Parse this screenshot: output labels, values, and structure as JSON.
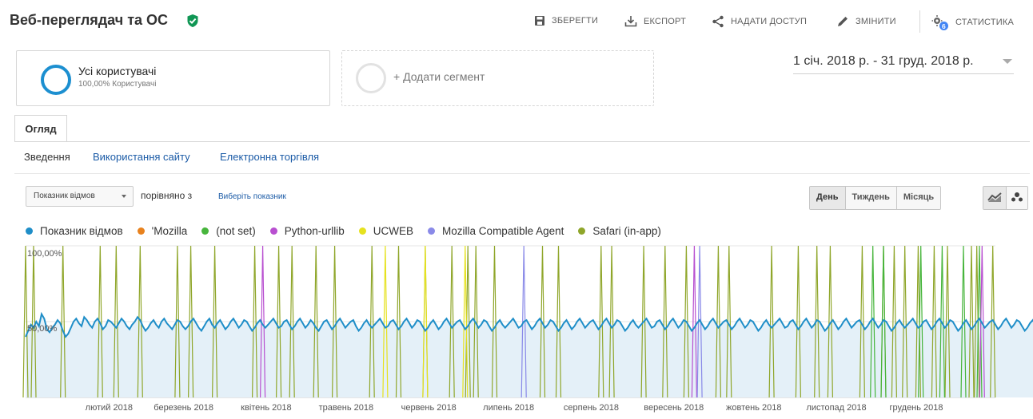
{
  "header": {
    "title": "Веб-переглядач та ОС",
    "save_label": "ЗБЕРЕГТИ",
    "export_label": "ЕКСПОРТ",
    "share_label": "НАДАТИ ДОСТУП",
    "edit_label": "ЗМІНИТИ",
    "insights_label": "СТАТИСТИКА",
    "insights_badge": "6"
  },
  "segments": {
    "active_name": "Усі користувачі",
    "active_sub": "100,00% Користувачі",
    "add_label": "+ Додати сегмент"
  },
  "date_range": "1 січ. 2018 р. - 31 груд. 2018 р.",
  "tabs": [
    "Огляд"
  ],
  "subnav": [
    "Зведення",
    "Використання сайту",
    "Електронна торгівля"
  ],
  "controls": {
    "metric_label": "Показник відмов",
    "compare_label": "порівняно з",
    "select_metric": "Виберіть показник",
    "granularity": [
      "День",
      "Тиждень",
      "Місяць"
    ],
    "active_granularity": "День"
  },
  "legend": [
    {
      "name": "Показник відмов",
      "color": "#1f8ec8"
    },
    {
      "name": "'Mozilla",
      "color": "#e8821e"
    },
    {
      "name": "(not set)",
      "color": "#47b53c"
    },
    {
      "name": "Python-urllib",
      "color": "#b84fd0"
    },
    {
      "name": "UCWEB",
      "color": "#e6e21e"
    },
    {
      "name": "Mozilla Compatible Agent",
      "color": "#8a8ae8"
    },
    {
      "name": "Safari (in-app)",
      "color": "#8fa62a"
    }
  ],
  "chart_data": {
    "type": "line",
    "title": "",
    "xlabel": "",
    "ylabel": "",
    "ylim": [
      0,
      100
    ],
    "y_ticks": [
      "100,00%",
      "50,00%"
    ],
    "x_tick_labels": [
      "лютий 2018",
      "березень 2018",
      "квітень 2018",
      "травень 2018",
      "червень 2018",
      "липень 2018",
      "серпень 2018",
      "вересень 2018",
      "жовтень 2018",
      "листопад 2018",
      "грудень 2018"
    ],
    "x_range": [
      "2018-01-01",
      "2018-12-31"
    ],
    "series": [
      {
        "name": "Показник відмов",
        "values": [
          40,
          44,
          48,
          46,
          50,
          47,
          55,
          52,
          45,
          43,
          46,
          48,
          51,
          49,
          44,
          40,
          42,
          46,
          50,
          52,
          49,
          47,
          53,
          51,
          48,
          46,
          50,
          52,
          49,
          45,
          47,
          51,
          50,
          48,
          46,
          49,
          52,
          50,
          47,
          45,
          48,
          50,
          53,
          51,
          47,
          44,
          46,
          49,
          51,
          48,
          46,
          50,
          52,
          49,
          47,
          45,
          48,
          51,
          50,
          47,
          45,
          47,
          50,
          52,
          49,
          46,
          44,
          47,
          50,
          52,
          48,
          46,
          49,
          51,
          48,
          45,
          47,
          50,
          52,
          49,
          46,
          48,
          51,
          50,
          47,
          44,
          46,
          49,
          51,
          48,
          46,
          48,
          50,
          52,
          49,
          46,
          47,
          50,
          51,
          48,
          45,
          47,
          50,
          52,
          49,
          46,
          48,
          51,
          49,
          46,
          44,
          47,
          50,
          51,
          48,
          45,
          47,
          50,
          52,
          49,
          46,
          48,
          50,
          51,
          47,
          44,
          46,
          49,
          51,
          48,
          46,
          48,
          50,
          52,
          49,
          46,
          47,
          50,
          51,
          48,
          45,
          47,
          50,
          52,
          49,
          46,
          48,
          51,
          50,
          47,
          44,
          46,
          49,
          51,
          48,
          45,
          47,
          50,
          52,
          49,
          46,
          48,
          50,
          51,
          48,
          45,
          47,
          50,
          52,
          49,
          46,
          48,
          51,
          50,
          47,
          44,
          46,
          49,
          51,
          48,
          46,
          48,
          50,
          52,
          49,
          46,
          47,
          50,
          51,
          48,
          45,
          47,
          50,
          52,
          49,
          46,
          48,
          51,
          50,
          47,
          44,
          46,
          49,
          51,
          48,
          45,
          47,
          50,
          52,
          49,
          46,
          48,
          50,
          51,
          48,
          45,
          47,
          50,
          52,
          49,
          46,
          48,
          51,
          50,
          47,
          44,
          46,
          49,
          51,
          48,
          46,
          48,
          50,
          52,
          49,
          46,
          47,
          50,
          51,
          48,
          45,
          47,
          50,
          52,
          49,
          46,
          48,
          51,
          50,
          47,
          44,
          46,
          49,
          51,
          48,
          45,
          47,
          50,
          52,
          49,
          46,
          48,
          50,
          51,
          48,
          45,
          47,
          50,
          52,
          49,
          46,
          48,
          51,
          50,
          47,
          44,
          46,
          49,
          51,
          48,
          46,
          48,
          50,
          52,
          49,
          46,
          47,
          50,
          51,
          48,
          45,
          47,
          50,
          52,
          49,
          46,
          48,
          51,
          50,
          47,
          44,
          46,
          49,
          51,
          48,
          45,
          47,
          50,
          52,
          49,
          46,
          48,
          50,
          51,
          48,
          45,
          47,
          50,
          52,
          49,
          46,
          48,
          51,
          50,
          47,
          44,
          46,
          49,
          51,
          48,
          46,
          48,
          50,
          52,
          49,
          46,
          47,
          50,
          51,
          48,
          45,
          47,
          50,
          52,
          49,
          46,
          48,
          51,
          50,
          47,
          44,
          46,
          49,
          51,
          48,
          45,
          47,
          50,
          52,
          49,
          46,
          48,
          50,
          51,
          48,
          45,
          47,
          50,
          52,
          49,
          46,
          48,
          51,
          50,
          47,
          44,
          46,
          49,
          51,
          48,
          46,
          48,
          50,
          53
        ]
      },
      {
        "name": "Safari (in-app)",
        "spikes_day_index": [
          0,
          3,
          14,
          28,
          34,
          43,
          57,
          62,
          71,
          86,
          95,
          100,
          109,
          116,
          130,
          140,
          150,
          160,
          166,
          169,
          176,
          194,
          200,
          216,
          220,
          232,
          240,
          248,
          260,
          264,
          280,
          290,
          297,
          302,
          314,
          322,
          326,
          330,
          335,
          341,
          346,
          355,
          357,
          363
        ]
      },
      {
        "name": "(not set)",
        "spikes_day_index": [
          318,
          322,
          336,
          344,
          352,
          358
        ]
      },
      {
        "name": "Python-urllib",
        "spikes_day_index": [
          89,
          251,
          359
        ]
      },
      {
        "name": "UCWEB",
        "spikes_day_index": [
          135,
          150,
          165
        ]
      },
      {
        "name": "Mozilla Compatible Agent",
        "spikes_day_index": [
          187,
          253
        ]
      }
    ]
  }
}
